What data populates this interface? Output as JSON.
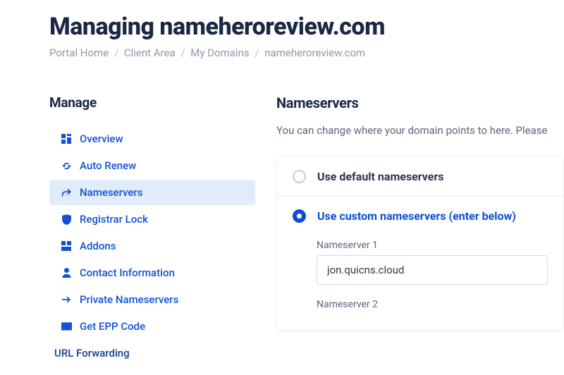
{
  "title": "Managing nameheroreview.com",
  "breadcrumb": {
    "items": [
      "Portal Home",
      "Client Area",
      "My Domains",
      "nameheroreview.com"
    ]
  },
  "sidebar": {
    "heading": "Manage",
    "items": [
      {
        "label": "Overview"
      },
      {
        "label": "Auto Renew"
      },
      {
        "label": "Nameservers"
      },
      {
        "label": "Registrar Lock"
      },
      {
        "label": "Addons"
      },
      {
        "label": "Contact Information"
      },
      {
        "label": "Private Nameservers"
      },
      {
        "label": "Get EPP Code"
      },
      {
        "label": "URL Forwarding"
      }
    ]
  },
  "main": {
    "heading": "Nameservers",
    "description": "You can change where your domain points to here. Please",
    "options": {
      "default": "Use default nameservers",
      "custom": "Use custom nameservers (enter below)"
    },
    "fields": {
      "ns1_label": "Nameserver 1",
      "ns1_value": "jon.quicns.cloud",
      "ns2_label": "Nameserver 2"
    }
  }
}
